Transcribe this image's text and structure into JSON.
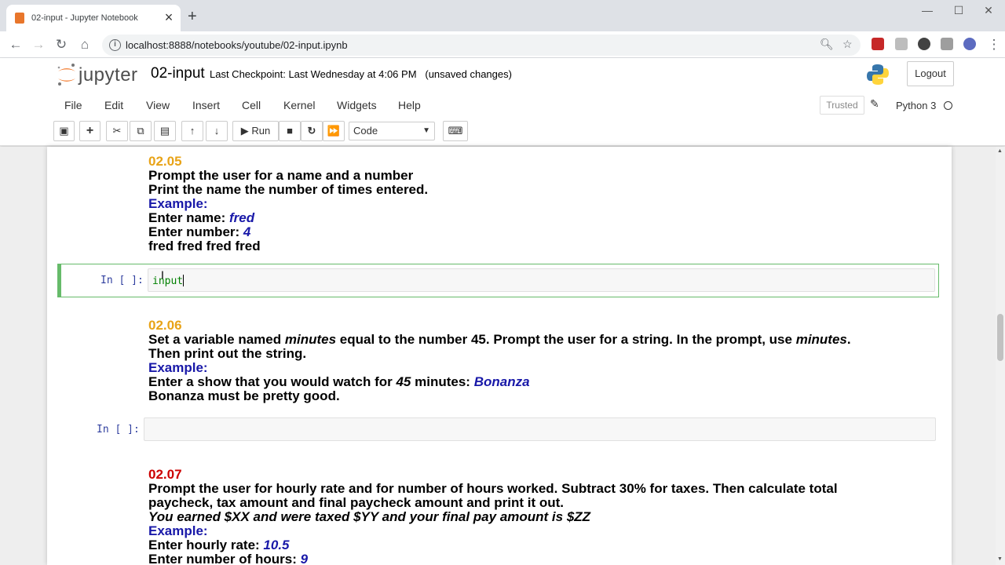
{
  "browser": {
    "tab_title": "02-input - Jupyter Notebook",
    "tab_close": "×",
    "new_tab": "+",
    "url": "localhost:8888/notebooks/youtube/02-input.ipynb",
    "win_min": "—",
    "win_max": "☐",
    "win_close": "✕"
  },
  "jupyter": {
    "logo_text": "jupyter",
    "notebook_name": "02-input",
    "checkpoint": "Last Checkpoint: Last Wednesday at 4:06 PM",
    "unsaved": "(unsaved changes)",
    "logout": "Logout",
    "menu": [
      "File",
      "Edit",
      "View",
      "Insert",
      "Cell",
      "Kernel",
      "Widgets",
      "Help"
    ],
    "trusted": "Trusted",
    "kernel": "Python 3",
    "run_label": "Run",
    "cell_type": "Code"
  },
  "cells": {
    "c205": {
      "num": "02.05",
      "l1": "Prompt the user for a name and a number",
      "l2": "Print the name the number of times entered.",
      "example": "Example:",
      "l3a": "Enter name: ",
      "l3b": "fred",
      "l4a": "Enter number: ",
      "l4b": "4",
      "l5": "fred fred fred fred"
    },
    "code1": {
      "prompt": "In [ ]:",
      "code": "input"
    },
    "c206": {
      "num": "02.06",
      "l1a": "Set a variable named ",
      "l1b": "minutes",
      "l1c": " equal to the number 45. Prompt the user for a string. In the prompt, use ",
      "l1d": "minutes",
      "l1e": ".",
      "l2": "Then print out the string.",
      "example": "Example:",
      "l3a": "Enter a show that you would watch for ",
      "l3b": "45",
      "l3c": " minutes: ",
      "l3d": "Bonanza",
      "l4": "Bonanza must be pretty good."
    },
    "code2": {
      "prompt": "In [ ]:",
      "code": ""
    },
    "c207": {
      "num": "02.07",
      "l1": "Prompt the user for hourly rate and for number of hours worked. Subtract 30% for taxes. Then calculate total",
      "l2": "paycheck, tax amount and final paycheck amount and print it out.",
      "l3": "You earned $XX and were taxed $YY and your final pay amount is $ZZ",
      "example": "Example:",
      "l4a": "Enter hourly rate: ",
      "l4b": "10.5",
      "l5a": "Enter number of hours: ",
      "l5b": "9"
    }
  },
  "colors": {
    "accent_green": "#66bb6a",
    "number_yellow": "#e8a317",
    "number_red": "#cc0000",
    "example_blue": "#1818a8"
  }
}
